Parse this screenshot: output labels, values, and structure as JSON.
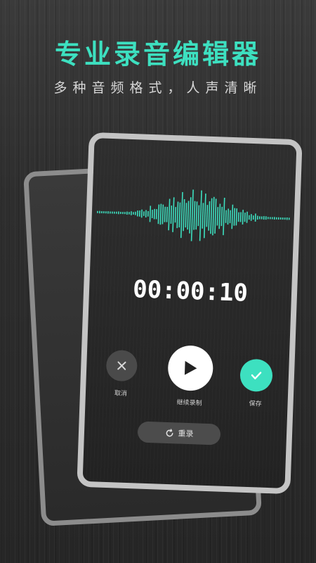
{
  "header": {
    "title": "专业录音编辑器",
    "subtitle": "多种音频格式，人声清晰"
  },
  "recorder": {
    "timer": "00:00:10",
    "controls": {
      "cancel_label": "取消",
      "resume_label": "继续录制",
      "save_label": "保存"
    },
    "reset_label": "重录"
  },
  "colors": {
    "accent": "#3de0c0",
    "background": "#2e2e2e"
  },
  "icons": {
    "cancel": "close-icon",
    "resume": "play-icon",
    "save": "check-icon",
    "reset": "refresh-icon"
  }
}
